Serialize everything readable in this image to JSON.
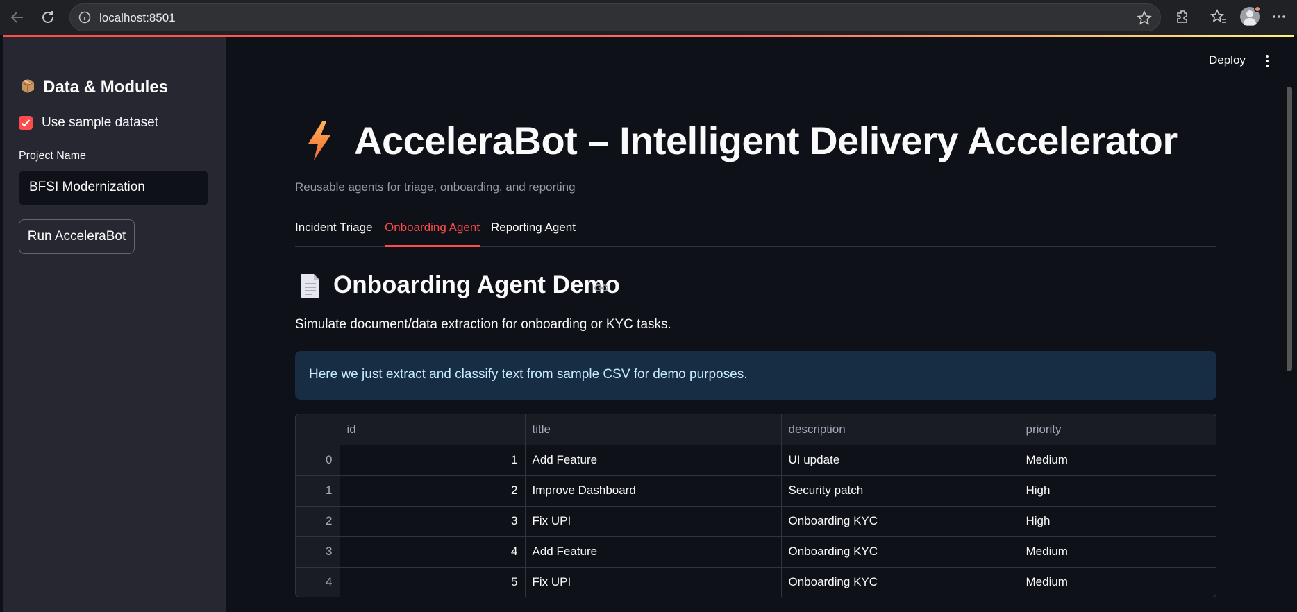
{
  "browser": {
    "url": "localhost:8501"
  },
  "sidebar": {
    "heading": "Data & Modules",
    "checkbox_label": "Use sample dataset",
    "checkbox_checked": true,
    "field_label": "Project Name",
    "project_name_value": "BFSI Modernization",
    "run_button_label": "Run AcceleraBot"
  },
  "header": {
    "deploy_label": "Deploy"
  },
  "main": {
    "title": "AcceleraBot – Intelligent Delivery Accelerator",
    "subtitle": "Reusable agents for triage, onboarding, and reporting",
    "tabs": [
      {
        "label": "Incident Triage",
        "active": false
      },
      {
        "label": "Onboarding Agent",
        "active": true
      },
      {
        "label": "Reporting Agent",
        "active": false
      }
    ],
    "section_title": "Onboarding Agent Demo",
    "section_description": "Simulate document/data extraction for onboarding or KYC tasks.",
    "info_text": "Here we just extract and classify text from sample CSV for demo purposes."
  },
  "table": {
    "columns": [
      "",
      "id",
      "title",
      "description",
      "priority"
    ],
    "rows": [
      {
        "index": "0",
        "id": "1",
        "title": "Add Feature",
        "description": "UI update",
        "priority": "Medium"
      },
      {
        "index": "1",
        "id": "2",
        "title": "Improve Dashboard",
        "description": "Security patch",
        "priority": "High"
      },
      {
        "index": "2",
        "id": "3",
        "title": "Fix UPI",
        "description": "Onboarding KYC",
        "priority": "High"
      },
      {
        "index": "3",
        "id": "4",
        "title": "Add Feature",
        "description": "Onboarding KYC",
        "priority": "Medium"
      },
      {
        "index": "4",
        "id": "5",
        "title": "Fix UPI",
        "description": "Onboarding KYC",
        "priority": "Medium"
      }
    ]
  },
  "colors": {
    "accent": "#ff4b4b",
    "background": "#0e1117",
    "sidebar": "#262730",
    "info_bg": "#172d43"
  }
}
